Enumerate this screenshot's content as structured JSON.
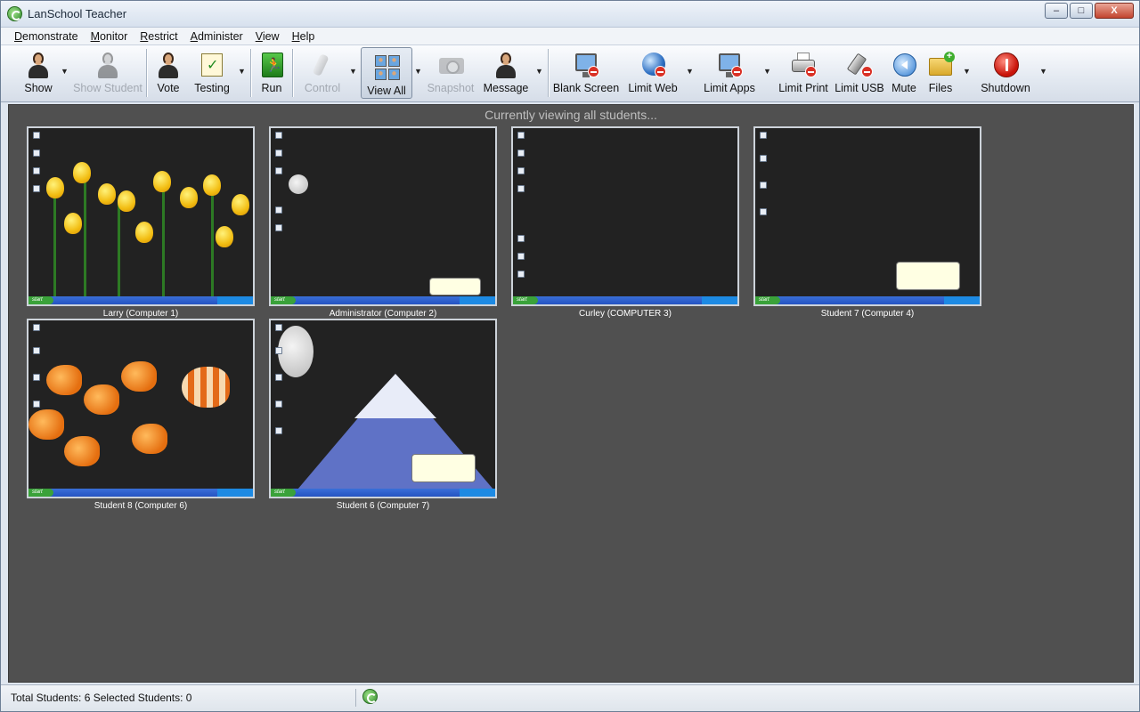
{
  "window": {
    "title": "LanSchool Teacher"
  },
  "window_buttons": {
    "minimize": "–",
    "maximize": "□",
    "close": "X"
  },
  "menu": [
    {
      "prefix": "",
      "accel": "D",
      "rest": "emonstrate"
    },
    {
      "prefix": "",
      "accel": "M",
      "rest": "onitor"
    },
    {
      "prefix": "",
      "accel": "R",
      "rest": "estrict"
    },
    {
      "prefix": "",
      "accel": "A",
      "rest": "dminister"
    },
    {
      "prefix": "",
      "accel": "V",
      "rest": "iew"
    },
    {
      "prefix": "",
      "accel": "H",
      "rest": "elp"
    }
  ],
  "toolbar": {
    "show": "Show",
    "show_student": "Show Student",
    "vote": "Vote",
    "testing": "Testing",
    "run": "Run",
    "control": "Control",
    "view_all": "View All",
    "snapshot": "Snapshot",
    "message": "Message",
    "blank_screen": "Blank Screen",
    "limit_web": "Limit Web",
    "limit_apps": "Limit Apps",
    "limit_print": "Limit Print",
    "limit_usb": "Limit USB",
    "mute": "Mute",
    "files": "Files",
    "shutdown": "Shutdown",
    "dropdown_glyph": "▼"
  },
  "icons": {
    "show": "teacher-icon",
    "show_student": "student-screen-icon",
    "vote": "vote-icon",
    "testing": "testing-icon",
    "run": "run-icon",
    "control": "joystick-icon",
    "view_all": "grid-icon",
    "snapshot": "camera-icon",
    "message": "message-icon",
    "blank_screen": "blank-screen-icon",
    "limit_web": "globe-icon",
    "limit_apps": "apps-icon",
    "limit_print": "printer-icon",
    "limit_usb": "usb-icon",
    "mute": "speaker-icon",
    "files": "folder-icon",
    "shutdown": "power-icon"
  },
  "content": {
    "status_message": "Currently viewing all students...",
    "students": [
      {
        "caption": "Larry (Computer 1)"
      },
      {
        "caption": "Administrator (Computer 2)"
      },
      {
        "caption": "Curley (COMPUTER 3)"
      },
      {
        "caption": "Student 7 (Computer 4)"
      },
      {
        "caption": "Student 8 (Computer 6)"
      },
      {
        "caption": "Student 6 (Computer 7)"
      }
    ]
  },
  "statusbar": {
    "text": "Total Students: 6  Selected Students: 0"
  },
  "colors": {
    "content_bg": "#505050",
    "caption": "#ffffff",
    "status_message": "#bfbfbf"
  }
}
